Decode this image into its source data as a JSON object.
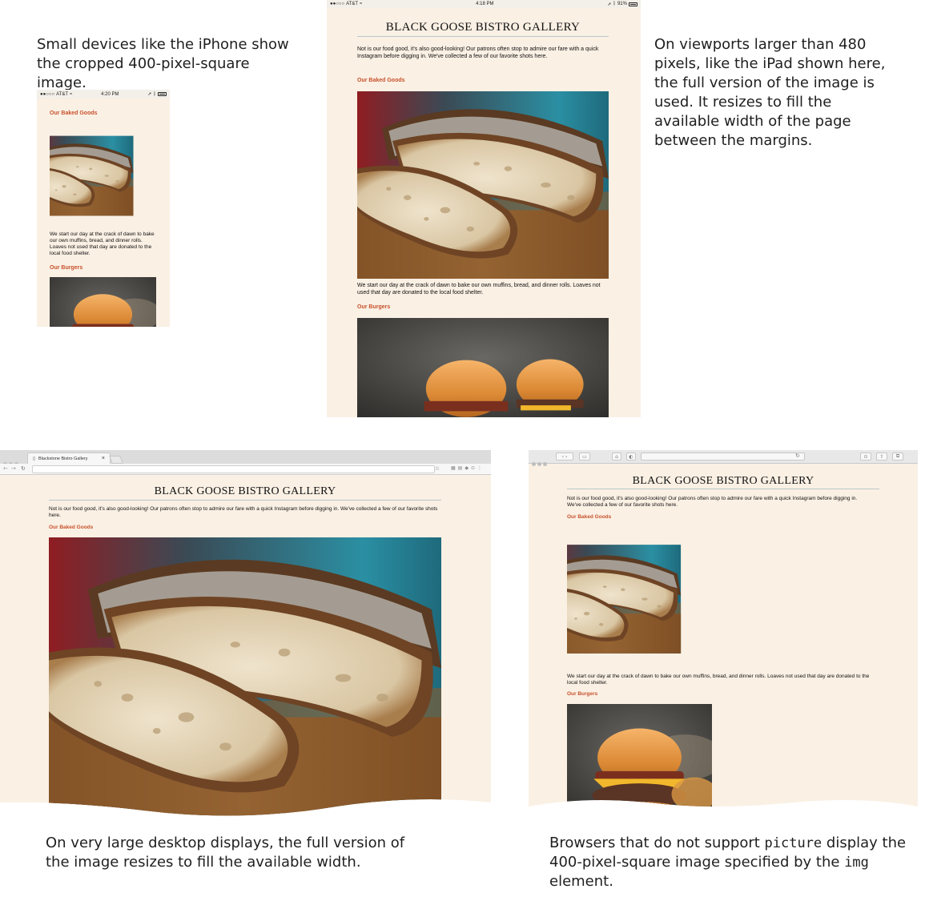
{
  "captions": {
    "iphone": "Small devices like the iPhone show the cropped 400-pixel-square image.",
    "ipad": "On viewports larger than 480 pixels, like the iPad shown here, the full version of the image is used. It resizes to fill the available width of the page between the margins.",
    "desktop": "On very large desktop displays, the full version of the image resizes to fill the available width.",
    "fallback_pre": "Browsers that do not support ",
    "fallback_code1": "picture",
    "fallback_mid": " display the 400-pixel-square image specified by the ",
    "fallback_code2": "img",
    "fallback_post": " element."
  },
  "site": {
    "title": "BLACK GOOSE BISTRO GALLERY",
    "intro": "Not is our food good, it's also good-looking! Our patrons often stop to admire our fare with a quick Instagram before digging in. We've collected a few of our favorite shots here.",
    "section_baked": "Our Baked Goods",
    "baked_desc": "We start our day at the crack of dawn to bake our own muffins, bread, and dinner rolls. Loaves not used that day are donated to the local food shelter.",
    "section_burgers": "Our Burgers"
  },
  "iphone_status": {
    "carrier": "AT&T",
    "time": "4:20 PM"
  },
  "ipad_status": {
    "carrier": "AT&T",
    "time": "4:18 PM",
    "battery": "91%"
  },
  "chrome": {
    "tab_title": "Blackstone Bistro Gallery",
    "close": "×"
  },
  "icons": {
    "wifi": "wifi-icon",
    "bluetooth": "bluetooth-icon",
    "battery": "battery-icon",
    "star": "star-icon",
    "reload": "reload-icon",
    "back": "back-icon",
    "forward": "forward-icon"
  },
  "colors": {
    "page_bg": "#faf0e4",
    "heading_accent": "#c8512b"
  }
}
